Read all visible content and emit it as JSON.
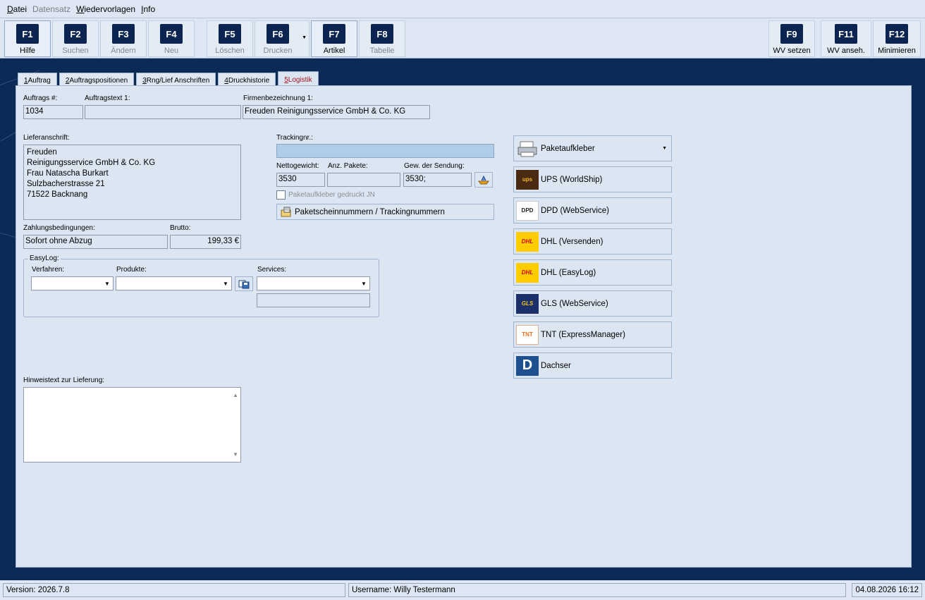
{
  "menu": {
    "items": [
      {
        "mnemonic": "D",
        "rest": "atei"
      },
      {
        "label": "Datensatz"
      },
      {
        "mnemonic": "W",
        "rest": "iedervorlagen"
      },
      {
        "mnemonic": "I",
        "rest": "nfo"
      }
    ]
  },
  "toolbar": {
    "buttons": [
      {
        "key": "F1",
        "label": "Hilfe"
      },
      {
        "key": "F2",
        "label": "Suchen"
      },
      {
        "key": "F3",
        "label": "Ändern"
      },
      {
        "key": "F4",
        "label": "Neu"
      },
      {
        "key": "F5",
        "label": "Löschen"
      },
      {
        "key": "F6",
        "label": "Drucken"
      },
      {
        "key": "F7",
        "label": "Artikel"
      },
      {
        "key": "F8",
        "label": "Tabelle"
      },
      {
        "key": "F9",
        "label": "WV setzen"
      },
      {
        "key": "F11",
        "label": "WV anseh."
      },
      {
        "key": "F12",
        "label": "Minimieren"
      }
    ]
  },
  "tabs": [
    {
      "num": "1",
      "label": " Auftrag"
    },
    {
      "num": "2",
      "label": " Auftragspositionen"
    },
    {
      "num": "3",
      "label": " Rng/Lief Anschriften"
    },
    {
      "num": "4",
      "label": " Druckhistorie"
    },
    {
      "num": "5",
      "label": " Logistik"
    }
  ],
  "form": {
    "auftrag_nr_label": "Auftrags #:",
    "auftrag_nr": "1034",
    "auftragtext_label": "Auftragstext 1:",
    "auftragtext": "",
    "firma_label": "Firmenbezeichnung 1:",
    "firma": "Freuden Reinigungsservice GmbH & Co. KG",
    "lieferanschrift_label": "Lieferanschrift:",
    "lieferanschrift": [
      "Freuden",
      "Reinigungsservice GmbH & Co. KG",
      "Frau Natascha Burkart",
      "Sulzbacherstrasse 21",
      "71522 Backnang"
    ],
    "zahlung_label": "Zahlungsbedingungen:",
    "zahlung": "Sofort ohne Abzug",
    "brutto_label": "Brutto:",
    "brutto": "199,33 €",
    "tracking_label": "Trackingnr.:",
    "tracking": "",
    "netto_label": "Nettogewicht:",
    "netto": "3530",
    "pakete_label": "Anz. Pakete:",
    "pakete": "",
    "gew_label": "Gew. der Sendung:",
    "gew": "3530;",
    "gedruckt_label": "Paketaufkleber gedruckt JN",
    "paketschein_label": "Paketscheinnummern / Trackingnummern",
    "easylog_title": "EasyLog:",
    "verfahren_label": "Verfahren:",
    "produkte_label": "Produkte:",
    "services_label": "Services:",
    "hinweis_label": "Hinweistext zur Lieferung:"
  },
  "shipping": [
    {
      "icon": "printer-icon",
      "label": "Paketaufkleber",
      "dropdown": true
    },
    {
      "icon": "ups-logo-icon",
      "label": "UPS (WorldShip)",
      "logo_text": "ups",
      "color": "#4a2a12"
    },
    {
      "icon": "dpd-logo-icon",
      "label": "DPD (WebService)",
      "logo_text": "DPD",
      "color": "#ffffff"
    },
    {
      "icon": "dhl-logo-icon",
      "label": "DHL (Versenden)",
      "logo_text": "DHL",
      "color": "#ffcc00"
    },
    {
      "icon": "dhl-logo-icon",
      "label": "DHL (EasyLog)",
      "logo_text": "DHL",
      "color": "#ffcc00"
    },
    {
      "icon": "gls-logo-icon",
      "label": "GLS (WebService)",
      "logo_text": "GLS",
      "color": "#1b2f6b"
    },
    {
      "icon": "tnt-logo-icon",
      "label": "TNT (ExpressManager)",
      "logo_text": "TNT",
      "color": "#ffffff"
    },
    {
      "icon": "dachser-logo-icon",
      "label": "Dachser",
      "logo_text": "D",
      "color": "#1e4f8f"
    }
  ],
  "status": {
    "version": "Version: 2026.7.8",
    "user": "Username: Willy Testermann",
    "datetime": "04.08.2026 16:12"
  }
}
